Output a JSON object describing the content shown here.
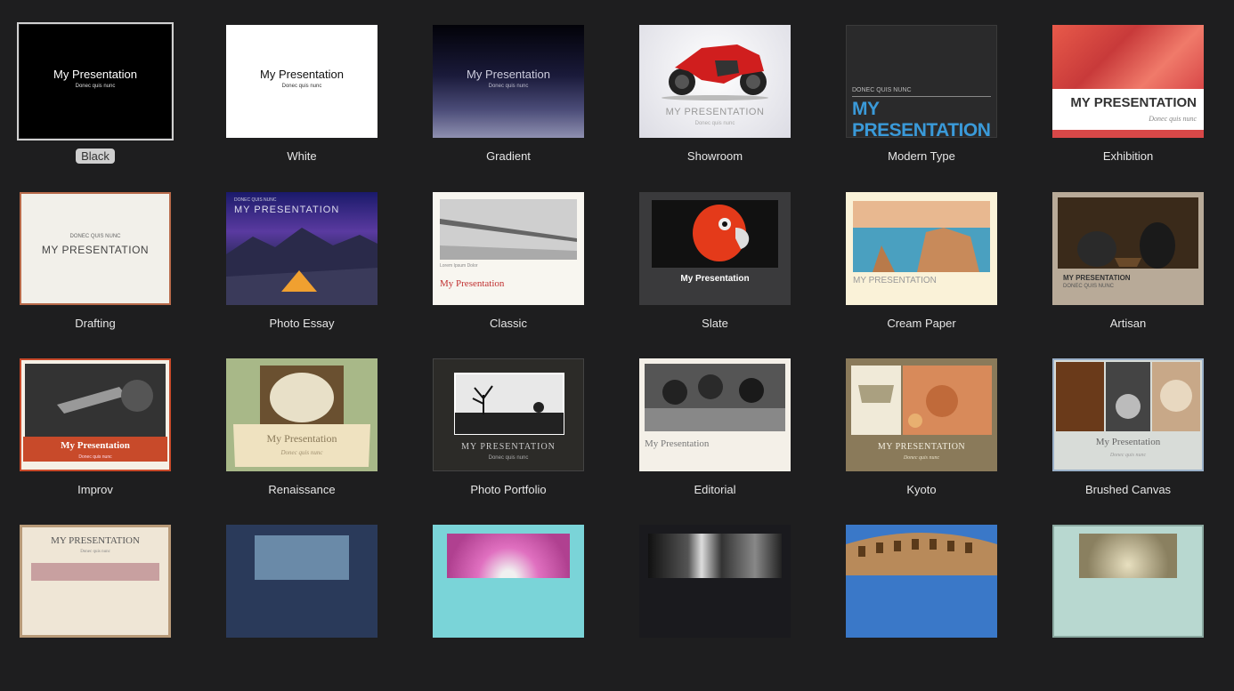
{
  "themes": [
    {
      "name": "Black",
      "title": "My Presentation",
      "subtitle": "Donec quis nunc"
    },
    {
      "name": "White",
      "title": "My Presentation",
      "subtitle": "Donec quis nunc"
    },
    {
      "name": "Gradient",
      "title": "My Presentation",
      "subtitle": "Donec quis nunc"
    },
    {
      "name": "Showroom",
      "title": "MY PRESENTATION",
      "subtitle": "Donec quis nunc"
    },
    {
      "name": "Modern Type",
      "title": "MY PRESENTATION",
      "subtitle": "DONEC QUIS NUNC"
    },
    {
      "name": "Exhibition",
      "title": "MY PRESENTATION",
      "subtitle": "Donec quis nunc"
    },
    {
      "name": "Drafting",
      "title": "MY PRESENTATION",
      "subtitle": "DONEC QUIS NUNC"
    },
    {
      "name": "Photo Essay",
      "title": "MY PRESENTATION",
      "subtitle": "DONEC QUIS NUNC"
    },
    {
      "name": "Classic",
      "title": "My Presentation",
      "subtitle": "Lorem Ipsum Dolor"
    },
    {
      "name": "Slate",
      "title": "My Presentation",
      "subtitle": ""
    },
    {
      "name": "Cream Paper",
      "title": "MY PRESENTATION",
      "subtitle": ""
    },
    {
      "name": "Artisan",
      "title": "MY PRESENTATION",
      "subtitle": "DONEC QUIS NUNC"
    },
    {
      "name": "Improv",
      "title": "My Presentation",
      "subtitle": "Donec quis nunc"
    },
    {
      "name": "Renaissance",
      "title": "My Presentation",
      "subtitle": "Donec quis nunc"
    },
    {
      "name": "Photo Portfolio",
      "title": "MY PRESENTATION",
      "subtitle": "Donec quis nunc"
    },
    {
      "name": "Editorial",
      "title": "My Presentation",
      "subtitle": ""
    },
    {
      "name": "Kyoto",
      "title": "MY PRESENTATION",
      "subtitle": "Donec quis nunc"
    },
    {
      "name": "Brushed Canvas",
      "title": "My Presentation",
      "subtitle": "Donec quis nunc"
    },
    {
      "name": "",
      "title": "MY PRESENTATION",
      "subtitle": "Donec quis nunc"
    }
  ],
  "selected_index": 0,
  "colors": {
    "background": "#1e1e1f",
    "accent_blue": "#3a9ad9",
    "selection": "#cfcfcf"
  }
}
